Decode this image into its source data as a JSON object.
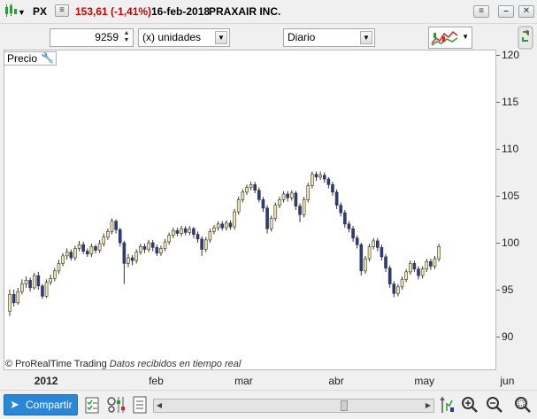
{
  "window": {
    "symbol": "PX",
    "price_change": "153,61 (-1,41%)",
    "date": "16-feb-2018",
    "company": "PRAXAIR INC.",
    "price_change_color": "#cc0000"
  },
  "toolbar": {
    "quantity": "9259",
    "units_select": "(x) unidades",
    "period_select": "Diario"
  },
  "chart_panel": {
    "label": "Precio",
    "credit_brand": "© ProRealTime Trading",
    "credit_note": "Datos recibidos en tiempo real"
  },
  "bottom": {
    "share_label": "Compartir"
  },
  "chart_data": {
    "type": "candlestick",
    "ylim": [
      86.5,
      120.5
    ],
    "y_ticks": [
      "120",
      "115",
      "110",
      "105",
      "100",
      "95",
      "90"
    ],
    "x_labels": [
      {
        "label": "2012",
        "index": 6,
        "bold": true
      },
      {
        "label": "feb",
        "index": 34
      },
      {
        "label": "mar",
        "index": 55
      },
      {
        "label": "abr",
        "index": 78
      },
      {
        "label": "may",
        "index": 99
      },
      {
        "label": "jun",
        "index": 120
      }
    ],
    "up_color": "#f1e9a8",
    "down_color": "#2b3a8f",
    "candles": [
      [
        92.7,
        94.5,
        92.2,
        95.0
      ],
      [
        94.5,
        93.6,
        93.2,
        95.0
      ],
      [
        93.6,
        94.8,
        93.4,
        95.2
      ],
      [
        94.8,
        95.6,
        94.5,
        96.1
      ],
      [
        95.6,
        96.0,
        95.2,
        96.4
      ],
      [
        96.0,
        95.2,
        94.8,
        96.3
      ],
      [
        95.2,
        96.5,
        95.0,
        96.8
      ],
      [
        96.5,
        95.4,
        95.0,
        96.9
      ],
      [
        95.4,
        94.3,
        94.0,
        95.6
      ],
      [
        94.3,
        95.8,
        94.1,
        96.1
      ],
      [
        95.8,
        96.2,
        95.5,
        96.6
      ],
      [
        96.2,
        97.0,
        95.9,
        97.3
      ],
      [
        97.0,
        97.8,
        96.7,
        98.2
      ],
      [
        97.8,
        98.6,
        97.5,
        98.9
      ],
      [
        98.6,
        99.0,
        98.2,
        99.4
      ],
      [
        99.0,
        98.4,
        98.1,
        99.3
      ],
      [
        98.4,
        99.4,
        98.1,
        99.7
      ],
      [
        99.4,
        99.8,
        99.1,
        100.2
      ],
      [
        99.8,
        99.1,
        98.8,
        100.1
      ],
      [
        99.1,
        98.8,
        98.5,
        99.4
      ],
      [
        98.8,
        99.6,
        98.5,
        99.9
      ],
      [
        99.6,
        99.2,
        98.9,
        99.8
      ],
      [
        99.2,
        99.9,
        98.9,
        100.3
      ],
      [
        99.9,
        100.6,
        99.6,
        101.0
      ],
      [
        100.6,
        101.2,
        100.3,
        101.5
      ],
      [
        101.2,
        102.3,
        100.9,
        102.6
      ],
      [
        102.3,
        101.4,
        101.0,
        102.5
      ],
      [
        101.4,
        100.0,
        99.6,
        101.6
      ],
      [
        100.0,
        97.8,
        95.6,
        100.2
      ],
      [
        97.8,
        98.4,
        97.4,
        98.8
      ],
      [
        98.4,
        98.1,
        97.6,
        98.7
      ],
      [
        98.1,
        99.0,
        97.8,
        99.3
      ],
      [
        99.0,
        99.6,
        98.7,
        99.9
      ],
      [
        99.6,
        99.3,
        98.9,
        99.9
      ],
      [
        99.3,
        100.0,
        99.0,
        100.3
      ],
      [
        100.0,
        99.5,
        99.1,
        100.3
      ],
      [
        99.5,
        98.9,
        98.6,
        99.8
      ],
      [
        98.9,
        99.4,
        98.6,
        99.7
      ],
      [
        99.4,
        100.1,
        99.1,
        100.4
      ],
      [
        100.1,
        100.8,
        99.8,
        101.1
      ],
      [
        100.8,
        101.3,
        100.5,
        101.6
      ],
      [
        101.3,
        101.0,
        100.7,
        101.6
      ],
      [
        101.0,
        101.5,
        100.7,
        101.8
      ],
      [
        101.5,
        101.1,
        100.8,
        101.8
      ],
      [
        101.1,
        101.5,
        100.8,
        101.8
      ],
      [
        101.5,
        100.9,
        100.5,
        101.7
      ],
      [
        100.9,
        100.4,
        100.0,
        101.2
      ],
      [
        100.4,
        99.3,
        98.6,
        100.7
      ],
      [
        99.3,
        100.3,
        99.0,
        100.6
      ],
      [
        100.3,
        101.2,
        100.0,
        101.5
      ],
      [
        101.2,
        101.6,
        100.9,
        101.9
      ],
      [
        101.6,
        102.0,
        101.3,
        102.3
      ],
      [
        102.0,
        101.6,
        101.3,
        102.3
      ],
      [
        101.6,
        102.1,
        101.3,
        102.4
      ],
      [
        102.1,
        101.7,
        101.4,
        102.4
      ],
      [
        101.7,
        103.3,
        101.4,
        103.6
      ],
      [
        103.3,
        104.6,
        103.0,
        104.9
      ],
      [
        104.6,
        105.4,
        104.3,
        105.7
      ],
      [
        105.4,
        105.9,
        105.1,
        106.2
      ],
      [
        105.9,
        106.2,
        105.6,
        106.5
      ],
      [
        106.2,
        105.6,
        105.3,
        106.5
      ],
      [
        105.6,
        104.6,
        104.3,
        105.9
      ],
      [
        104.6,
        103.7,
        103.3,
        104.9
      ],
      [
        103.7,
        101.5,
        101.0,
        104.0
      ],
      [
        101.5,
        102.6,
        101.2,
        102.9
      ],
      [
        102.6,
        104.0,
        102.3,
        104.3
      ],
      [
        104.0,
        104.6,
        103.7,
        104.9
      ],
      [
        104.6,
        105.2,
        104.3,
        105.5
      ],
      [
        105.2,
        104.8,
        104.4,
        105.5
      ],
      [
        104.8,
        105.3,
        104.5,
        105.6
      ],
      [
        105.3,
        103.9,
        103.5,
        105.5
      ],
      [
        103.9,
        103.0,
        102.2,
        104.2
      ],
      [
        103.0,
        104.6,
        102.7,
        104.9
      ],
      [
        104.6,
        106.1,
        104.3,
        106.4
      ],
      [
        106.1,
        107.3,
        105.8,
        107.6
      ],
      [
        107.3,
        107.0,
        106.6,
        107.6
      ],
      [
        107.0,
        107.2,
        106.7,
        107.6
      ],
      [
        107.2,
        106.8,
        106.4,
        107.5
      ],
      [
        106.8,
        106.2,
        105.8,
        107.0
      ],
      [
        106.2,
        105.4,
        105.0,
        106.5
      ],
      [
        105.4,
        104.0,
        103.6,
        105.7
      ],
      [
        104.0,
        103.2,
        102.8,
        104.3
      ],
      [
        103.2,
        102.0,
        101.6,
        103.5
      ],
      [
        102.0,
        101.5,
        101.1,
        102.3
      ],
      [
        101.5,
        100.5,
        100.1,
        101.8
      ],
      [
        100.5,
        99.8,
        99.4,
        100.8
      ],
      [
        99.8,
        97.0,
        96.5,
        100.0
      ],
      [
        97.0,
        98.3,
        96.7,
        98.6
      ],
      [
        98.3,
        99.6,
        98.0,
        99.9
      ],
      [
        99.6,
        100.2,
        99.3,
        100.5
      ],
      [
        100.2,
        99.5,
        99.1,
        100.5
      ],
      [
        99.5,
        98.5,
        98.1,
        99.8
      ],
      [
        98.5,
        97.3,
        96.9,
        98.8
      ],
      [
        97.3,
        95.6,
        95.2,
        97.6
      ],
      [
        95.6,
        94.6,
        94.2,
        95.9
      ],
      [
        94.6,
        95.3,
        94.3,
        95.6
      ],
      [
        95.3,
        96.1,
        95.0,
        96.4
      ],
      [
        96.1,
        96.9,
        95.8,
        97.2
      ],
      [
        96.9,
        97.8,
        96.6,
        98.1
      ],
      [
        97.8,
        97.2,
        96.9,
        98.1
      ],
      [
        97.2,
        96.5,
        96.1,
        97.5
      ],
      [
        96.5,
        97.2,
        96.2,
        97.5
      ],
      [
        97.2,
        98.0,
        96.9,
        98.3
      ],
      [
        98.0,
        97.5,
        97.1,
        98.3
      ],
      [
        97.5,
        98.3,
        97.2,
        98.6
      ],
      [
        98.3,
        99.6,
        98.0,
        99.9
      ]
    ]
  }
}
